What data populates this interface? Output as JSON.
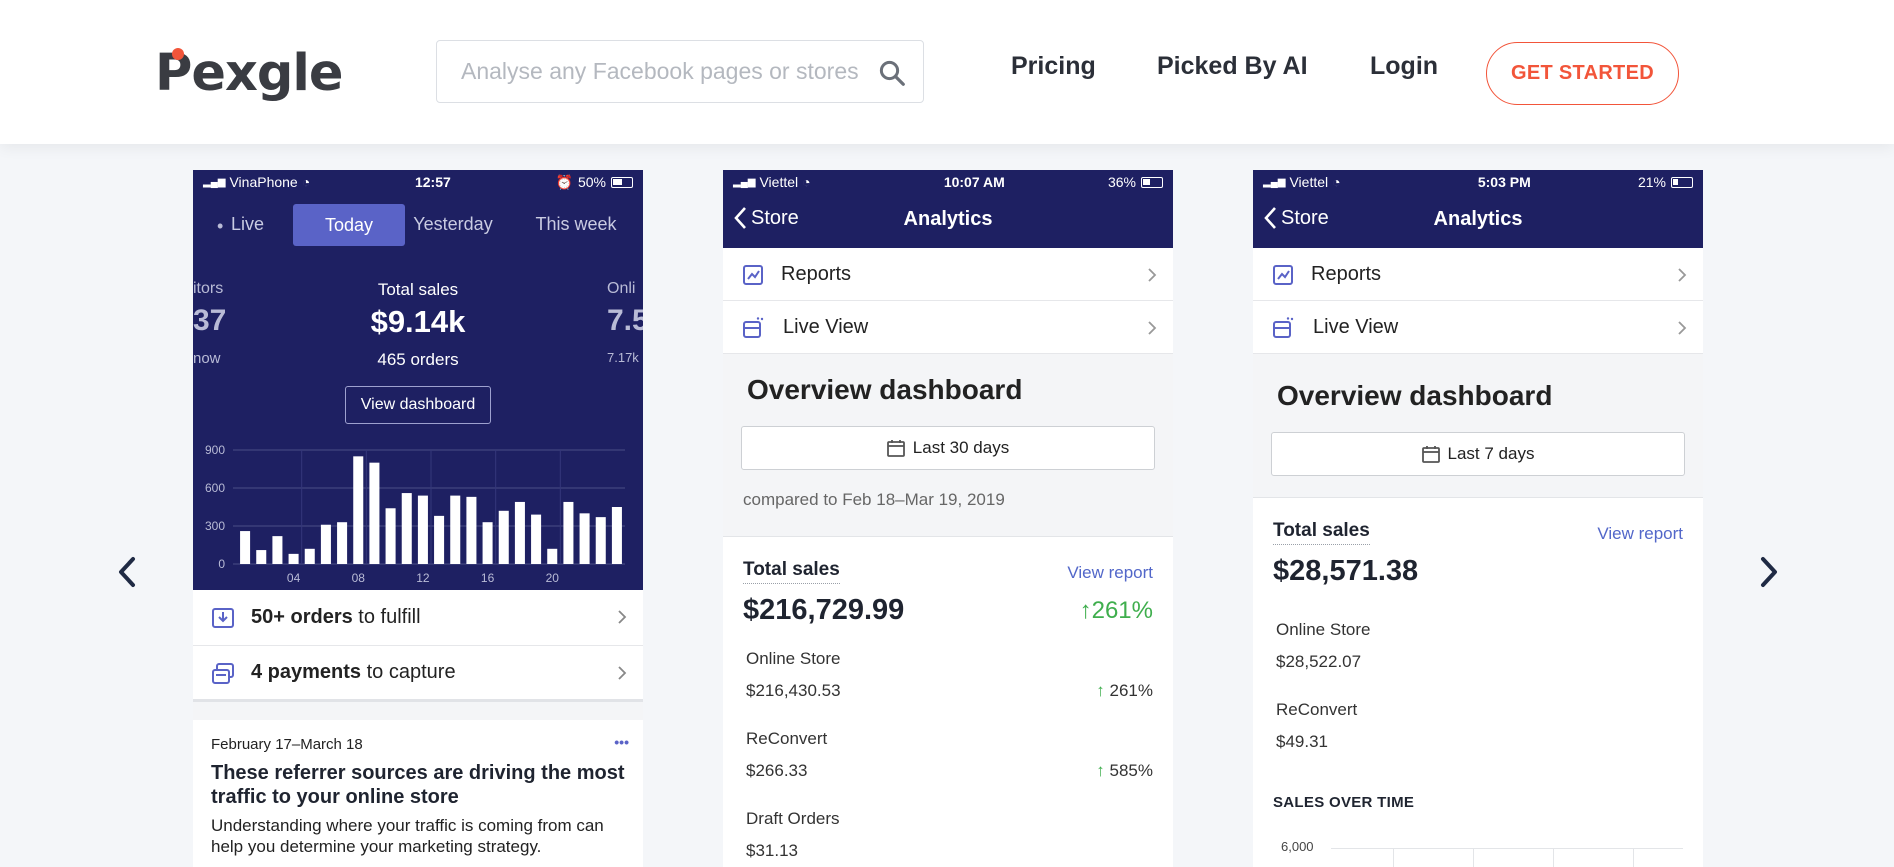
{
  "brand": {
    "name": "Pexgle",
    "accent": "#f2553a",
    "navy": "#1e2062"
  },
  "search": {
    "placeholder": "Analyse any Facebook pages or stores"
  },
  "nav": {
    "pricing": "Pricing",
    "picked": "Picked By AI",
    "login": "Login",
    "cta": "GET STARTED"
  },
  "carousel": {
    "prev_icon": "chevron-left-icon",
    "next_icon": "chevron-right-icon"
  },
  "phone1": {
    "status": {
      "carrier": "VinaPhone",
      "time": "12:57",
      "battery": "50%"
    },
    "tabs": [
      "Live",
      "Today",
      "Yesterday",
      "This week"
    ],
    "active_tab": "Today",
    "left_stat": {
      "label": "itors",
      "value": "37",
      "sub": "now"
    },
    "total": {
      "label": "Total sales",
      "value": "$9.14k",
      "orders": "465 orders"
    },
    "right_stat": {
      "label": "Onli",
      "value": "7.5",
      "sub": "7.17k"
    },
    "dashboard_button": "View dashboard",
    "chart_data": {
      "type": "bar",
      "yticks": [
        "900",
        "600",
        "300",
        "0"
      ],
      "xticks": [
        "04",
        "08",
        "12",
        "16",
        "20"
      ],
      "ylim": [
        0,
        900
      ],
      "values": [
        260,
        110,
        220,
        80,
        120,
        310,
        330,
        850,
        800,
        440,
        560,
        540,
        380,
        540,
        530,
        330,
        420,
        490,
        390,
        120,
        490,
        400,
        370,
        450
      ]
    },
    "tasks": [
      {
        "bold": "50+ orders",
        "rest": " to fulfill",
        "icon": "inbox-download-icon"
      },
      {
        "bold": "4 payments",
        "rest": " to capture",
        "icon": "payments-icon"
      }
    ],
    "card": {
      "date": "February 17–March 18",
      "more": "•••",
      "title": "These referrer sources are driving the most traffic to your online store",
      "body": "Understanding where your traffic is coming from can help you determine your marketing strategy."
    }
  },
  "phone2": {
    "status": {
      "carrier": "Viettel",
      "time": "10:07 AM",
      "battery": "36%"
    },
    "back": "Store",
    "title": "Analytics",
    "menu": [
      "Reports",
      "Live View"
    ],
    "overview": "Overview dashboard",
    "range": "Last 30 days",
    "compared": "compared to Feb 18–Mar 19, 2019",
    "total_label": "Total sales",
    "view_report": "View report",
    "total_value": "$216,729.99",
    "total_change": "261%",
    "channels": [
      {
        "name": "Online Store",
        "value": "$216,430.53",
        "change": "261%"
      },
      {
        "name": "ReConvert",
        "value": "$266.33",
        "change": "585%"
      },
      {
        "name": "Draft Orders",
        "value": "$31.13",
        "change": ""
      }
    ]
  },
  "phone3": {
    "status": {
      "carrier": "Viettel",
      "time": "5:03 PM",
      "battery": "21%"
    },
    "back": "Store",
    "title": "Analytics",
    "menu": [
      "Reports",
      "Live View"
    ],
    "overview": "Overview dashboard",
    "range": "Last 7 days",
    "total_label": "Total sales",
    "view_report": "View report",
    "total_value": "$28,571.38",
    "channels": [
      {
        "name": "Online Store",
        "value": "$28,522.07"
      },
      {
        "name": "ReConvert",
        "value": "$49.31"
      }
    ],
    "sales_over_time": "SALES OVER TIME",
    "y_first": "6,000"
  }
}
